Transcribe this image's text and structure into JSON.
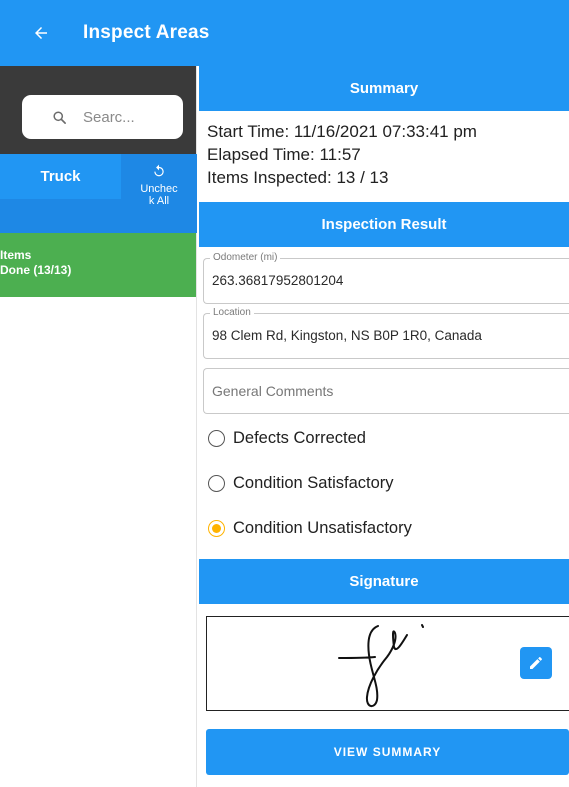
{
  "appbar": {
    "title": "Inspect Areas",
    "back_icon": "arrow-left-icon"
  },
  "sidebar": {
    "search_placeholder": "Searc...",
    "truck_label": "Truck",
    "uncheck_label": "Unchec k All",
    "items_line1": "Items",
    "items_line2": "Done (13/13)"
  },
  "summary": {
    "header": "Summary",
    "start_time": "Start Time: 11/16/2021 07:33:41 pm",
    "elapsed_time": "Elapsed Time: 11:57",
    "items_inspected": "Items Inspected: 13 / 13"
  },
  "inspection_result": {
    "header": "Inspection Result",
    "odometer_label": "Odometer (mi)",
    "odometer_value": "263.36817952801204",
    "location_label": "Location",
    "location_value": "98 Clem Rd, Kingston, NS B0P 1R0, Canada",
    "comments_placeholder": "General Comments",
    "options": [
      "Defects Corrected",
      "Condition Satisfactory",
      "Condition Unsatisfactory"
    ],
    "selected": "Condition Unsatisfactory"
  },
  "signature": {
    "header": "Signature"
  },
  "actions": {
    "view_summary": "VIEW SUMMARY"
  },
  "colors": {
    "primary": "#2196f3",
    "green": "#4caf50",
    "dark": "#3a3a3a",
    "radio_selected": "#ffb300"
  }
}
